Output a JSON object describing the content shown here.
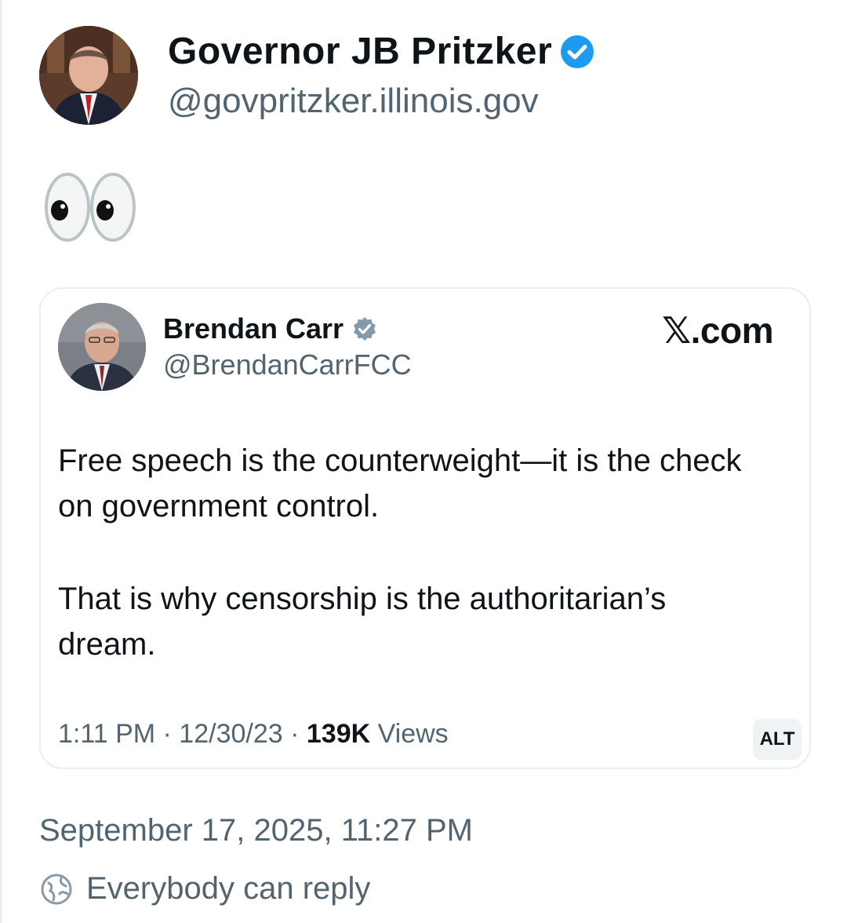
{
  "post": {
    "author_name": "Governor JB Pritzker",
    "author_handle": "@govpritzker.illinois.gov",
    "body_text": "👀",
    "timestamp": "September 17, 2025, 11:27 PM",
    "reply_setting": "Everybody can reply"
  },
  "quote": {
    "author_name": "Brendan Carr",
    "author_handle": "@BrendanCarrFCC",
    "source": "𝕏.com",
    "paragraphs": [
      "Free speech is the counterweight—it is the check on government control.",
      "That is why censorship is the authoritarian’s dream."
    ],
    "meta_time": "1:11 PM · 12/30/23 · ",
    "meta_views_count": "139K",
    "meta_views_label": " Views",
    "alt_badge": "ALT"
  },
  "icons": {
    "verified": "verified-badge-icon",
    "quote_verified": "verified-badge-icon",
    "reply": "reply-permission-icon"
  },
  "colors": {
    "verified_blue": "#1d9bf0",
    "quote_verified_gray": "#829aab",
    "text_primary": "#0f1419",
    "text_secondary": "#536471"
  }
}
